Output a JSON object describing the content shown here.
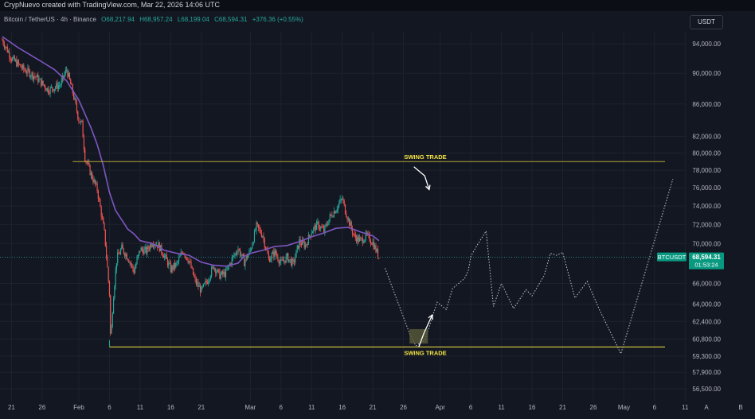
{
  "header": {
    "attribution": "CrypNuevo created with TradingView.com, Mar 22, 2026 14:06 UTC",
    "symbol": "Bitcoin / TetherUS · 4h · Binance",
    "open": "O68,217.94",
    "high": "H68,957.24",
    "low": "L68,199.04",
    "close": "C68,594.31",
    "change": "+376.36 (+0.55%)",
    "currency": "USDT"
  },
  "colors": {
    "background": "#131722",
    "up": "#26a69a",
    "down": "#ef5350",
    "ma": "#7e57c2",
    "swing_line": "#f5e642",
    "price_tag": "#089981"
  },
  "price_tag": {
    "symbol": "BTCUSDT",
    "price": "68,594.31",
    "countdown": "01:53:24"
  },
  "annotations": {
    "swing_top": "SWING TRADE",
    "swing_bottom": "SWING TRADE"
  },
  "chart_data": {
    "type": "candlestick",
    "title": "Bitcoin / TetherUS · 4h · Binance",
    "y_scale": "log",
    "ylim": [
      55000,
      97000
    ],
    "y_ticks": [
      94000,
      90000,
      86000,
      82000,
      80000,
      78000,
      76000,
      74000,
      72000,
      70000,
      66000,
      64000,
      62400,
      60800,
      59300,
      57900,
      56500
    ],
    "y_tick_labels": [
      "94,000.00",
      "90,000.00",
      "86,000.00",
      "82,000.00",
      "80,000.00",
      "78,000.00",
      "76,000.00",
      "74,000.00",
      "72,000.00",
      "70,000.00",
      "66,000.00",
      "64,000.00",
      "62,400.00",
      "60,800.00",
      "59,300.00",
      "57,900.00",
      "56,500.00"
    ],
    "x_labels": [
      "21",
      "26",
      "Feb",
      "6",
      "11",
      "16",
      "21",
      "Mar",
      "6",
      "11",
      "16",
      "21",
      "26",
      "Apr",
      "6",
      "11",
      "16",
      "21",
      "26",
      "May",
      "6",
      "11"
    ],
    "x_label_days": [
      -11,
      -6,
      0,
      5,
      10,
      15,
      20,
      28,
      33,
      38,
      43,
      48,
      53,
      59,
      64,
      69,
      74,
      79,
      84,
      89,
      94,
      99
    ],
    "last_price": 68594.31,
    "horizontal_lines": [
      {
        "name": "SWING TRADE",
        "value": 79000
      },
      {
        "name": "SWING TRADE",
        "value": 60100
      }
    ],
    "ohlc_path": [
      [
        -12.5,
        94500
      ],
      [
        -11,
        92000
      ],
      [
        -9,
        90500
      ],
      [
        -7,
        89500
      ],
      [
        -5,
        87800
      ],
      [
        -3,
        88500
      ],
      [
        -2,
        90500
      ],
      [
        -1,
        87500
      ],
      [
        0,
        84000
      ],
      [
        0.5,
        83500
      ],
      [
        1,
        79500
      ],
      [
        2,
        77500
      ],
      [
        3,
        75800
      ],
      [
        3.7,
        73000
      ],
      [
        4.2,
        71000
      ],
      [
        4.6,
        68000
      ],
      [
        5,
        65000
      ],
      [
        5.2,
        60500
      ],
      [
        5.6,
        64500
      ],
      [
        6.2,
        68500
      ],
      [
        7,
        69500
      ],
      [
        8,
        68600
      ],
      [
        9,
        67200
      ],
      [
        10,
        69400
      ],
      [
        11,
        69200
      ],
      [
        12,
        70200
      ],
      [
        13,
        69800
      ],
      [
        14,
        68700
      ],
      [
        15,
        67400
      ],
      [
        16,
        67900
      ],
      [
        17,
        69300
      ],
      [
        18,
        68200
      ],
      [
        19,
        66200
      ],
      [
        20,
        65300
      ],
      [
        21,
        66300
      ],
      [
        22,
        67700
      ],
      [
        23,
        66800
      ],
      [
        24,
        67000
      ],
      [
        25,
        68400
      ],
      [
        26,
        69500
      ],
      [
        27,
        68100
      ],
      [
        28,
        69300
      ],
      [
        29,
        71800
      ],
      [
        30,
        70900
      ],
      [
        31,
        68400
      ],
      [
        32,
        69100
      ],
      [
        33,
        68000
      ],
      [
        34,
        68600
      ],
      [
        35,
        67900
      ],
      [
        36,
        70200
      ],
      [
        37,
        69800
      ],
      [
        38,
        71300
      ],
      [
        39,
        72000
      ],
      [
        40,
        71300
      ],
      [
        41,
        72800
      ],
      [
        42,
        73700
      ],
      [
        43,
        74800
      ],
      [
        43.5,
        73500
      ],
      [
        44,
        72500
      ],
      [
        45,
        70700
      ],
      [
        46,
        70300
      ],
      [
        47,
        70800
      ],
      [
        48,
        70100
      ],
      [
        49,
        68594
      ]
    ],
    "ma_series": [
      [
        -12.5,
        95000
      ],
      [
        -10,
        93500
      ],
      [
        -8,
        92500
      ],
      [
        -6,
        91500
      ],
      [
        -4,
        90500
      ],
      [
        -2,
        89000
      ],
      [
        0,
        86500
      ],
      [
        2,
        83000
      ],
      [
        3,
        81000
      ],
      [
        4,
        78500
      ],
      [
        5,
        75500
      ],
      [
        6,
        73500
      ],
      [
        7,
        72500
      ],
      [
        8,
        71500
      ],
      [
        9,
        71000
      ],
      [
        10,
        70300
      ],
      [
        12,
        70000
      ],
      [
        14,
        69300
      ],
      [
        16,
        69000
      ],
      [
        18,
        68800
      ],
      [
        20,
        68100
      ],
      [
        22,
        67800
      ],
      [
        24,
        67700
      ],
      [
        26,
        68000
      ],
      [
        27,
        68700
      ],
      [
        28,
        69000
      ],
      [
        30,
        69300
      ],
      [
        32,
        69700
      ],
      [
        34,
        69800
      ],
      [
        36,
        70200
      ],
      [
        38,
        70700
      ],
      [
        40,
        71100
      ],
      [
        42,
        71600
      ],
      [
        44,
        71700
      ],
      [
        46,
        71200
      ],
      [
        48,
        70800
      ],
      [
        49,
        70300
      ]
    ],
    "projection": [
      [
        50,
        67500
      ],
      [
        54,
        61300
      ],
      [
        55,
        60200
      ],
      [
        56.5,
        60700
      ],
      [
        58,
        63300
      ],
      [
        58.5,
        64200
      ],
      [
        60,
        63500
      ],
      [
        61,
        65500
      ],
      [
        63,
        66500
      ],
      [
        63.6,
        67300
      ],
      [
        64,
        68700
      ],
      [
        65,
        69800
      ],
      [
        66.5,
        71300
      ],
      [
        67.7,
        63800
      ],
      [
        69,
        66000
      ],
      [
        71,
        63600
      ],
      [
        73,
        65400
      ],
      [
        74,
        64800
      ],
      [
        76,
        66800
      ],
      [
        77,
        69000
      ],
      [
        78,
        68800
      ],
      [
        79,
        69100
      ],
      [
        81,
        64600
      ],
      [
        83,
        66200
      ],
      [
        85,
        63500
      ],
      [
        88.5,
        59500
      ],
      [
        97,
        77000
      ]
    ],
    "swing_boxes": [
      {
        "label": "SWING TRADE",
        "x_from": 54,
        "x_to": 57,
        "y_from": 60400,
        "y_to": 61700
      }
    ],
    "arrows": [
      {
        "from": [
          54.7,
          78400
        ],
        "to": [
          57.2,
          75800
        ],
        "direction": "down"
      },
      {
        "from": [
          55.5,
          60100
        ],
        "to": [
          57.7,
          63000
        ],
        "direction": "up"
      }
    ]
  }
}
